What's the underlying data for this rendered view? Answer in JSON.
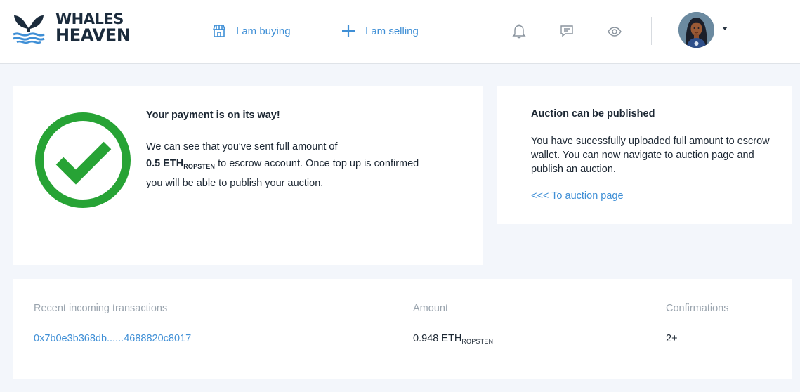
{
  "brand": {
    "line1": "WHALES",
    "line2": "HEAVEN",
    "logo_icon": "whale-tail-icon",
    "logo_color": "#1b2b3c",
    "wave_color": "#3f8fd6"
  },
  "nav": {
    "buying": {
      "label": "I am buying",
      "icon": "storefront-icon"
    },
    "selling": {
      "label": "I am selling",
      "icon": "plus-icon"
    }
  },
  "header_icons": [
    "bell-icon",
    "chat-icon",
    "eye-icon"
  ],
  "payment": {
    "title": "Your payment is on its way!",
    "line1": "We can see that you've sent full amount of",
    "amount": "0.5 ETH",
    "network": "ROPSTEN",
    "line2": " to escrow account. Once top up is confirmed",
    "line3": "you will be able to publish your auction.",
    "status_icon": "check-circle-icon",
    "status_color": "#27a335"
  },
  "auction": {
    "title": "Auction can be published",
    "body": "You have sucessfully uploaded full amount to escrow wallet. You can now navigate to auction page and publish an auction.",
    "link": "<<< To auction page"
  },
  "transactions": {
    "headers": [
      "Recent incoming transactions",
      "Amount",
      "Confirmations"
    ],
    "rows": [
      {
        "hash": "0x7b0e3b368db......4688820c8017",
        "amount": "0.948 ETH",
        "network": "ROPSTEN",
        "confirmations": "2+"
      }
    ]
  },
  "colors": {
    "accent": "#3f8fd6",
    "background": "#f3f6fb",
    "text": "#1c2733",
    "muted": "#9aa4ae"
  }
}
